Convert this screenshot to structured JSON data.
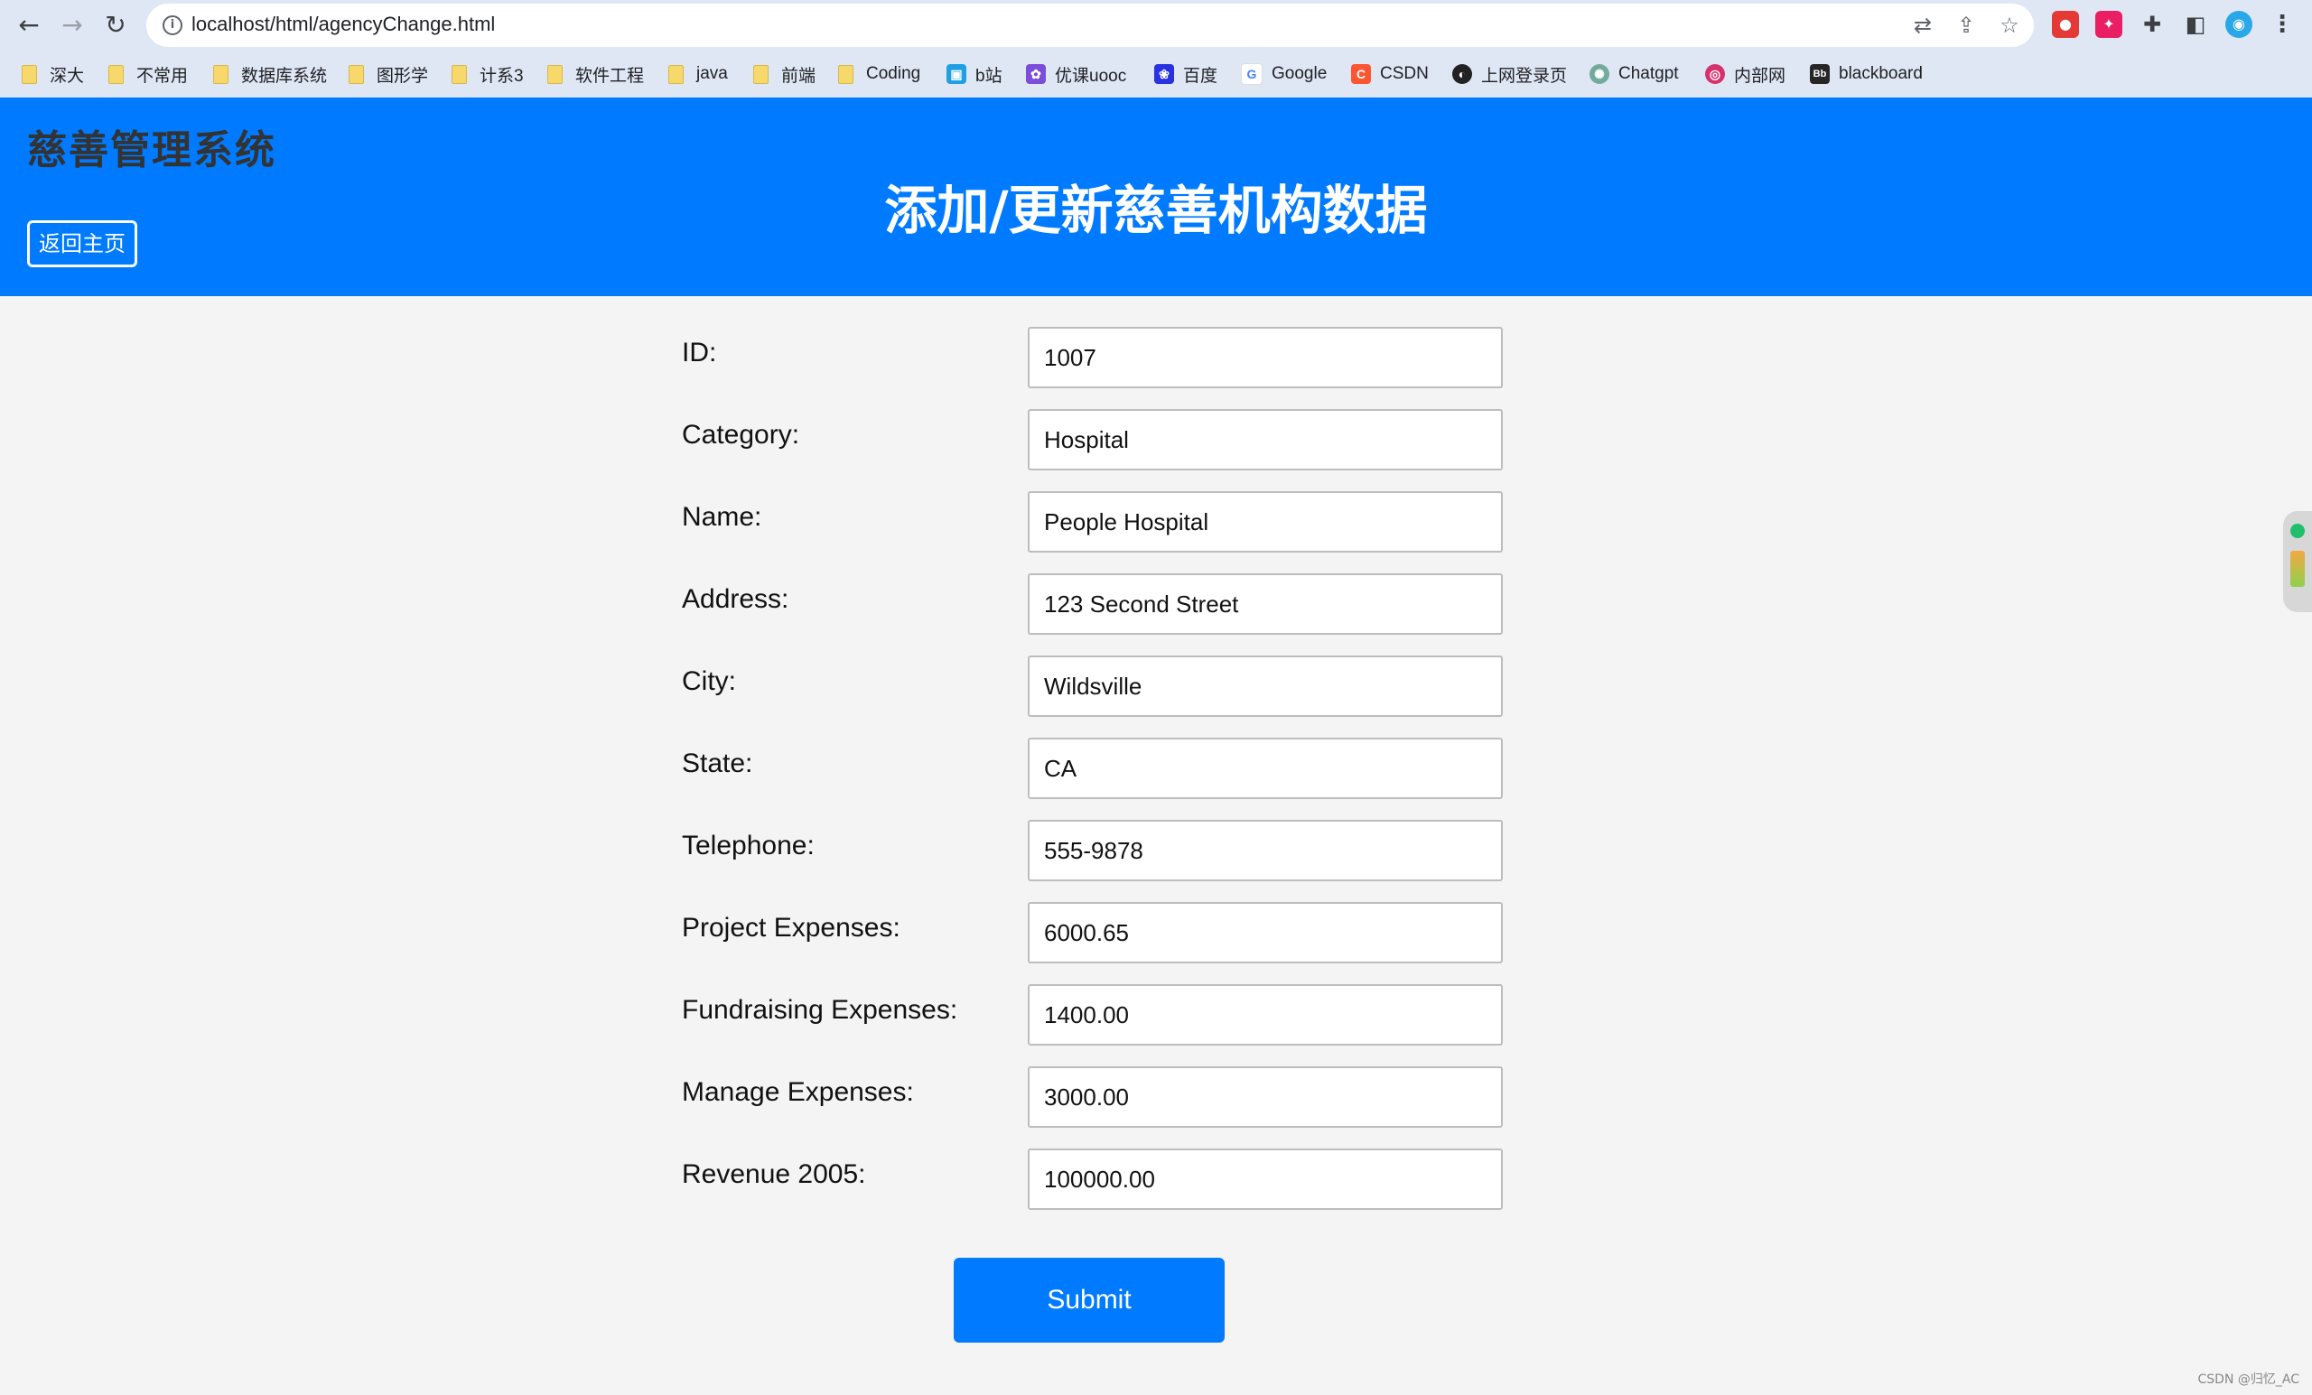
{
  "browser": {
    "url": "localhost/html/agencyChange.html",
    "bookmarks": [
      {
        "label": "深大",
        "icon": "folder-icon"
      },
      {
        "label": "不常用",
        "icon": "folder-icon"
      },
      {
        "label": "数据库系统",
        "icon": "folder-icon"
      },
      {
        "label": "图形学",
        "icon": "folder-icon"
      },
      {
        "label": "计系3",
        "icon": "folder-icon"
      },
      {
        "label": "软件工程",
        "icon": "folder-icon"
      },
      {
        "label": "java",
        "icon": "folder-icon"
      },
      {
        "label": "前端",
        "icon": "folder-icon"
      },
      {
        "label": "Coding",
        "icon": "folder-icon"
      },
      {
        "label": "b站",
        "icon": "bilibili-icon"
      },
      {
        "label": "优课uooc",
        "icon": "uooc-icon"
      },
      {
        "label": "百度",
        "icon": "baidu-icon"
      },
      {
        "label": "Google",
        "icon": "google-icon"
      },
      {
        "label": "CSDN",
        "icon": "csdn-icon"
      },
      {
        "label": "上网登录页",
        "icon": "globe-icon"
      },
      {
        "label": "Chatgpt",
        "icon": "chatgpt-icon"
      },
      {
        "label": "内部网",
        "icon": "intranet-icon"
      },
      {
        "label": "blackboard",
        "icon": "blackboard-icon"
      }
    ]
  },
  "header": {
    "system_title": "慈善管理系统",
    "home_button": "返回主页",
    "page_title": "添加/更新慈善机构数据",
    "background_color": "#007bff"
  },
  "form": {
    "fields": [
      {
        "label": "ID:",
        "value": "1007"
      },
      {
        "label": "Category:",
        "value": "Hospital"
      },
      {
        "label": "Name:",
        "value": "People Hospital"
      },
      {
        "label": "Address:",
        "value": "123 Second Street"
      },
      {
        "label": "City:",
        "value": "Wildsville"
      },
      {
        "label": "State:",
        "value": "CA"
      },
      {
        "label": "Telephone:",
        "value": "555-9878"
      },
      {
        "label": "Project Expenses:",
        "value": "6000.65"
      },
      {
        "label": "Fundraising Expenses:",
        "value": "1400.00"
      },
      {
        "label": "Manage Expenses:",
        "value": "3000.00"
      },
      {
        "label": "Revenue 2005:",
        "value": "100000.00"
      }
    ],
    "submit_label": "Submit"
  },
  "watermark": "CSDN @归忆_AC"
}
